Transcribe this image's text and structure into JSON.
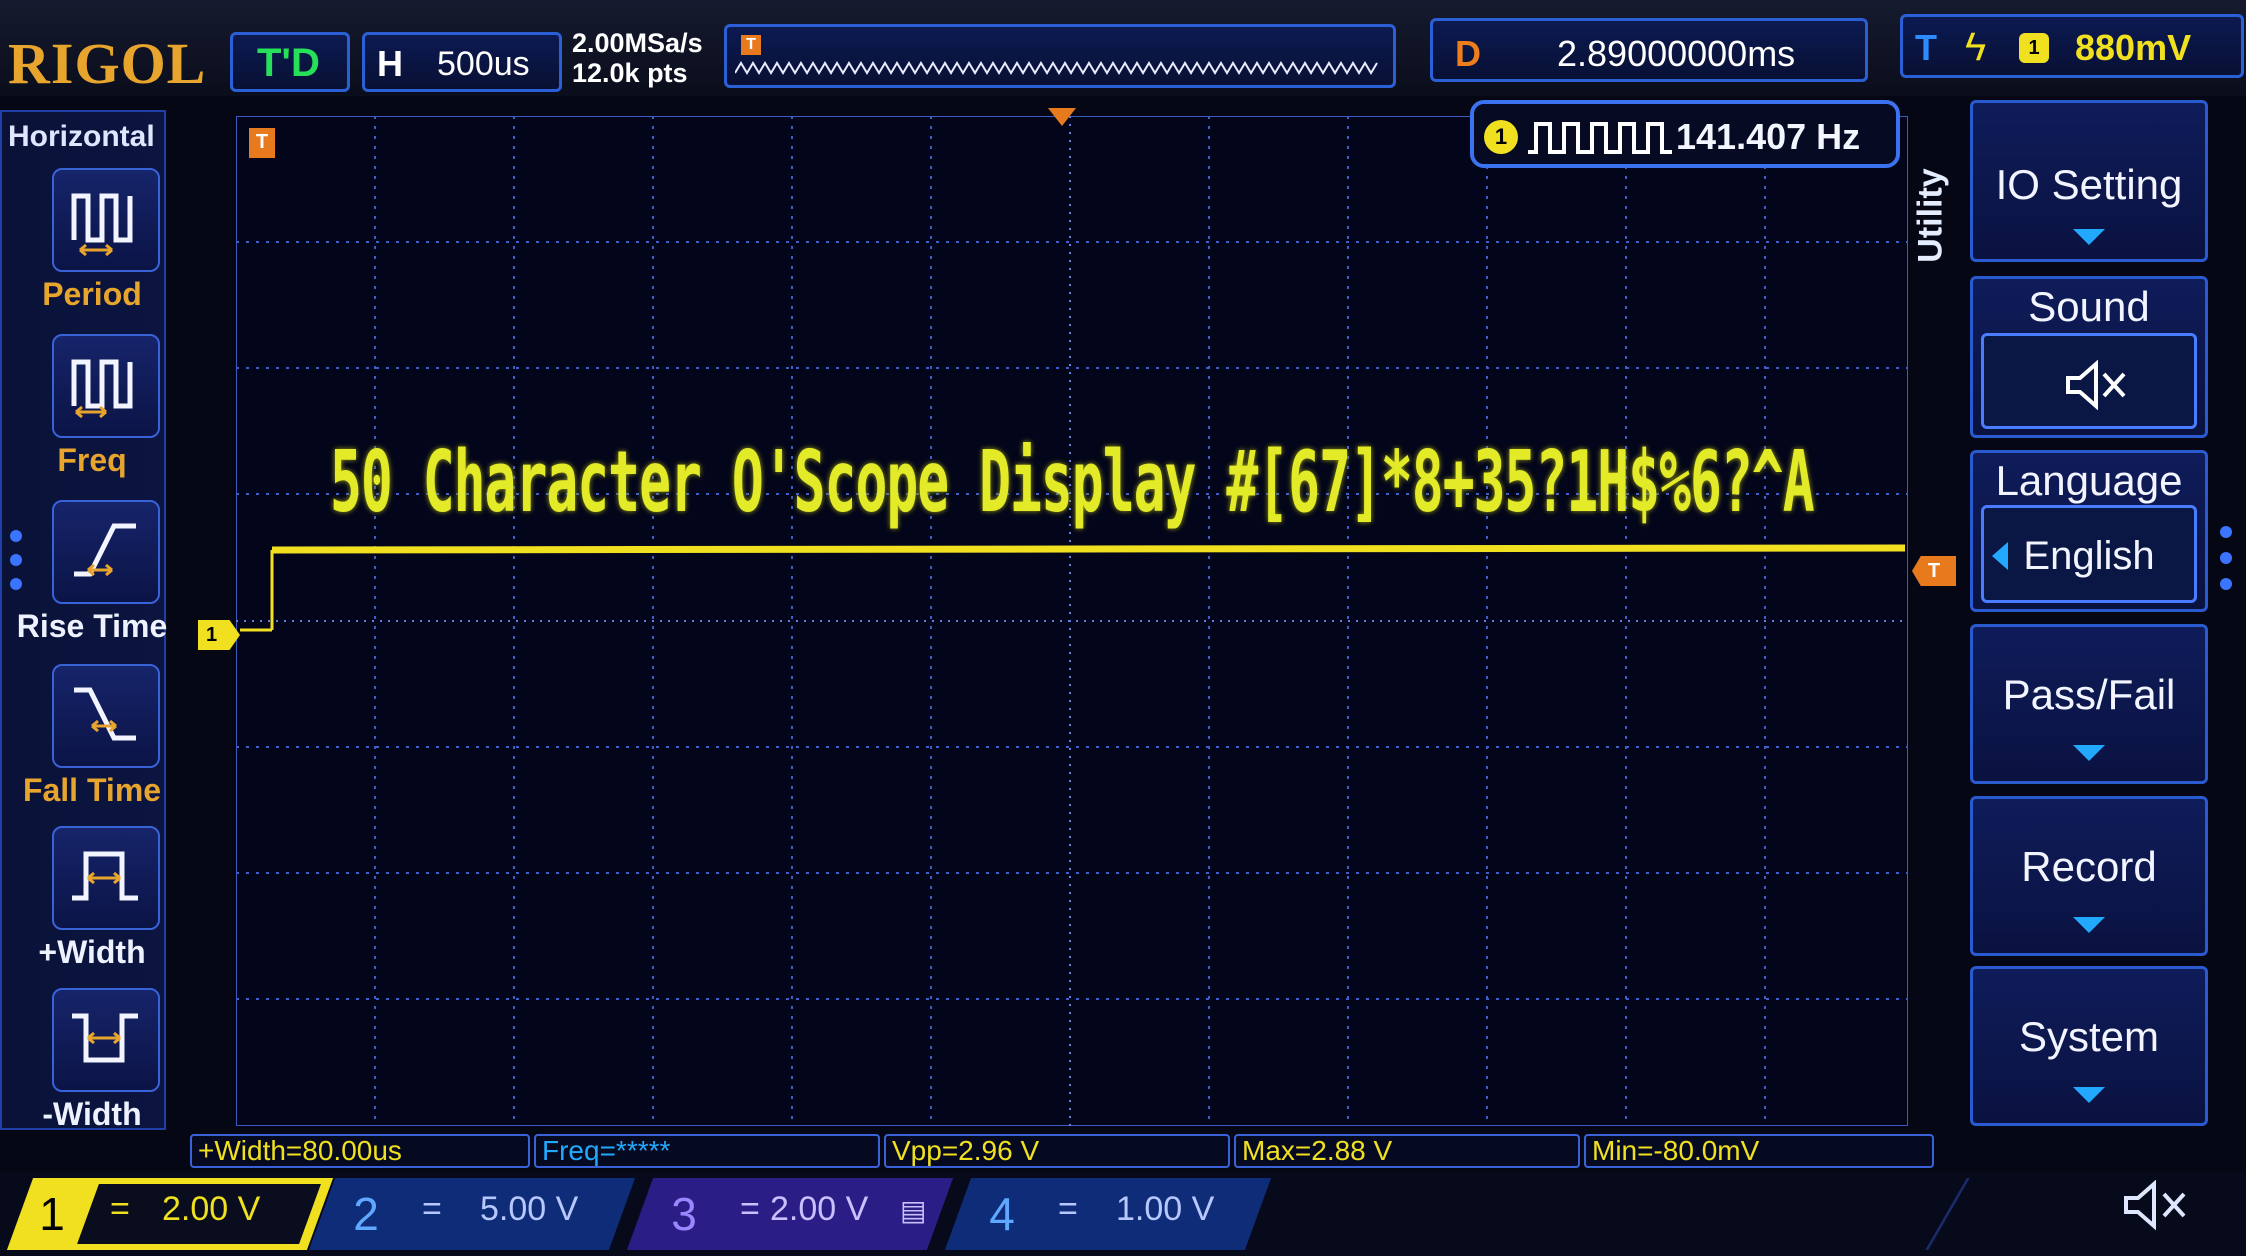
{
  "header": {
    "brand": "RIGOL",
    "run_state": "T'D",
    "timebase_label": "H",
    "timebase_value": "500us",
    "sample_rate": "2.00MSa/s",
    "memory_depth": "12.0k pts",
    "delay_label": "D",
    "delay_value": "2.89000000ms",
    "trigger_label": "T",
    "trigger_source": "1",
    "trigger_level": "880mV"
  },
  "left_panel": {
    "title": "Horizontal",
    "items": [
      {
        "label": "Period",
        "icon": "period-icon"
      },
      {
        "label": "Freq",
        "icon": "freq-icon"
      },
      {
        "label": "Rise Time",
        "icon": "rise-time-icon"
      },
      {
        "label": "Fall Time",
        "icon": "fall-time-icon"
      },
      {
        "label": "+Width",
        "icon": "positive-width-icon"
      },
      {
        "label": "-Width",
        "icon": "negative-width-icon"
      }
    ]
  },
  "display": {
    "trigger_marker": "T",
    "channel_marker": "1",
    "trigger_level_marker": "T",
    "overlay_text": "50 Character O'Scope Display #[67]*8+35?1H$%6?^A",
    "counter_channel": "1",
    "counter_value": "141.407 Hz"
  },
  "right_menu": {
    "section": "Utility",
    "items": [
      {
        "label": "IO Setting",
        "sub": ""
      },
      {
        "label": "Sound",
        "sub": "mute-icon"
      },
      {
        "label": "Language",
        "sub": "English"
      },
      {
        "label": "Pass/Fail",
        "sub": ""
      },
      {
        "label": "Record",
        "sub": ""
      },
      {
        "label": "System",
        "sub": ""
      }
    ]
  },
  "measurements": [
    {
      "text": "+Width=80.00us",
      "color": "#f0e020"
    },
    {
      "text": "Freq=*****",
      "color": "#22a8ff"
    },
    {
      "text": "Vpp=2.96 V",
      "color": "#f0e020"
    },
    {
      "text": "Max=2.88 V",
      "color": "#f0e020"
    },
    {
      "text": "Min=-80.0mV",
      "color": "#f0e020"
    }
  ],
  "channels": [
    {
      "num": "1",
      "coupling": "=",
      "scale": "2.00 V",
      "color": "#f0e020",
      "active": true
    },
    {
      "num": "2",
      "coupling": "=",
      "scale": "5.00 V",
      "color": "#22a8ff",
      "active": false
    },
    {
      "num": "3",
      "coupling": "=",
      "scale": "2.00 V",
      "color": "#b050ff",
      "active": false
    },
    {
      "num": "4",
      "coupling": "=",
      "scale": "1.00 V",
      "color": "#2f74ff",
      "active": false
    }
  ],
  "colors": {
    "ch1": "#f0e020",
    "brand": "#e8a52d",
    "trigger": "#e87a1e",
    "frame": "#2b5fd6"
  }
}
